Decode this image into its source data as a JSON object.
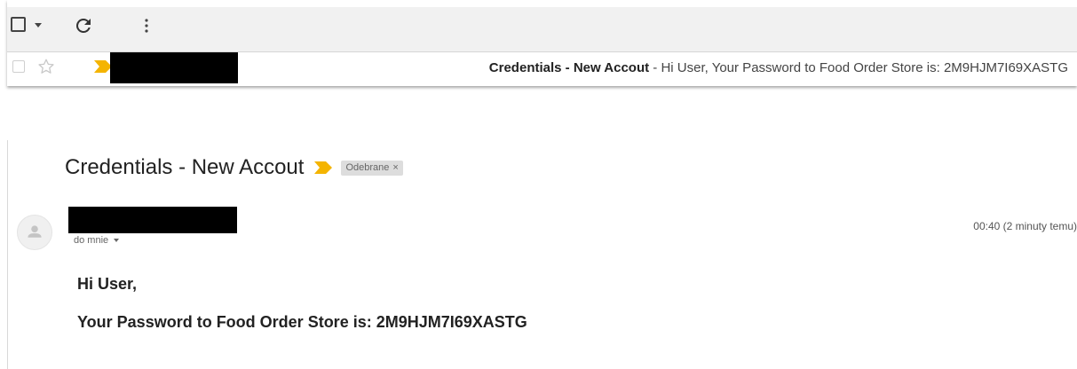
{
  "colors": {
    "importance_marker": "#f4b400",
    "toolbar_bg": "#f1f1f1",
    "redaction": "#000000"
  },
  "toolbar": {
    "select_checkbox_icon": "checkbox-icon",
    "select_caret_icon": "chevron-down-icon",
    "refresh_icon": "refresh-icon",
    "more_icon": "more-vert-icon"
  },
  "list_row": {
    "star_icon": "star-outline-icon",
    "importance_icon": "importance-marker-icon",
    "subject": "Credentials - New Accout",
    "separator": " - ",
    "snippet": "Hi User, Your Password to Food Order Store is: 2M9HJM7I69XASTG"
  },
  "message": {
    "subject": "Credentials - New Accout",
    "label": "Odebrane",
    "label_close": "×",
    "recipient": "do mnie",
    "timestamp": "00:40 (2 minuty temu)",
    "greeting": "Hi User,",
    "password_line": "Your Password to Food Order Store is: 2M9HJM7I69XASTG"
  }
}
